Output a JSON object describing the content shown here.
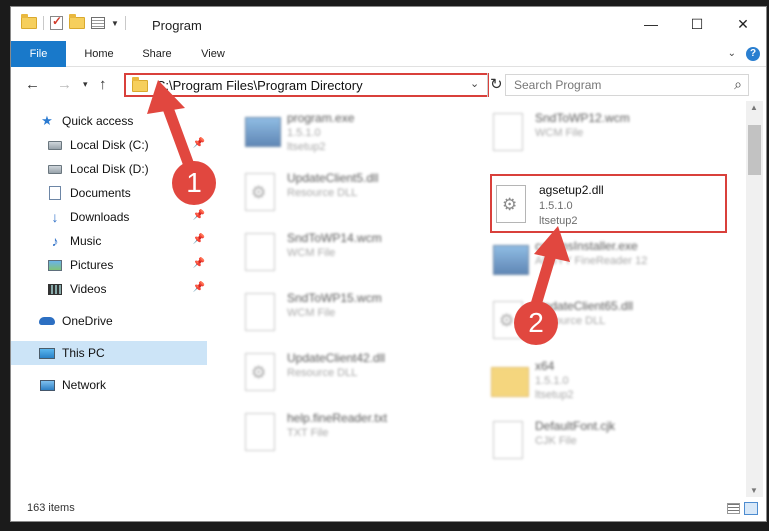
{
  "window": {
    "title": "Program",
    "minimize": "—",
    "maximize": "☐",
    "close": "✕"
  },
  "ribbon": {
    "tabs": [
      "File",
      "Home",
      "Share",
      "View"
    ],
    "expand": "⌄",
    "help": "?"
  },
  "nav": {
    "back": "←",
    "forward": "→",
    "recent": "▾",
    "up": "↑",
    "address": "C:\\Program Files\\Program Directory",
    "address_dropdown": "⌄",
    "refresh": "↻",
    "search_placeholder": "Search Program",
    "search_icon": "⌕"
  },
  "sidebar": {
    "items": [
      {
        "label": "Quick access",
        "icon": "star-icon",
        "pinned": false
      },
      {
        "label": "Local Disk (C:)",
        "icon": "disk-icon",
        "pinned": true
      },
      {
        "label": "Local Disk (D:)",
        "icon": "disk-icon",
        "pinned": false
      },
      {
        "label": "Documents",
        "icon": "documents-icon",
        "pinned": true
      },
      {
        "label": "Downloads",
        "icon": "downloads-icon",
        "pinned": true
      },
      {
        "label": "Music",
        "icon": "music-icon",
        "pinned": true
      },
      {
        "label": "Pictures",
        "icon": "pictures-icon",
        "pinned": true
      },
      {
        "label": "Videos",
        "icon": "videos-icon",
        "pinned": true
      },
      {
        "label": "OneDrive",
        "icon": "onedrive-icon",
        "pinned": false
      },
      {
        "label": "This PC",
        "icon": "this-pc-icon",
        "pinned": false,
        "selected": true
      },
      {
        "label": "Network",
        "icon": "network-icon",
        "pinned": false
      }
    ],
    "pin_glyph": "📌"
  },
  "files": {
    "left": [
      {
        "name": "program.exe",
        "line2": "1.5.1.0",
        "line3": "ltsetup2",
        "type": "exe"
      },
      {
        "name": "UpdateClient5.dll",
        "line2": "Resource DLL",
        "line3": "",
        "type": "dll"
      },
      {
        "name": "SndToWP14.wcm",
        "line2": "WCM File",
        "line3": "",
        "type": "doc"
      },
      {
        "name": "SndToWP15.wcm",
        "line2": "WCM File",
        "line3": "",
        "type": "doc"
      },
      {
        "name": "UpdateClient42.dll",
        "line2": "Resource DLL",
        "line3": "",
        "type": "dll"
      },
      {
        "name": "help.fineReader.txt",
        "line2": "TXT File",
        "line3": "",
        "type": "doc"
      }
    ],
    "right": [
      {
        "name": "SndToWP12.wcm",
        "line2": "WCM File",
        "line3": "",
        "type": "doc"
      },
      {
        "name": "agsetup2.dll",
        "line2": "1.5.1.0",
        "line3": "ltsetup2",
        "type": "dll",
        "highlighted": true
      },
      {
        "name": "commsInstaller.exe",
        "line2": "ABBYY FineReader 12",
        "line3": "",
        "type": "exe"
      },
      {
        "name": "UpdateClient65.dll",
        "line2": "Resource DLL",
        "line3": "",
        "type": "dll"
      },
      {
        "name": "x64",
        "line2": "1.5.1.0",
        "line3": "ltsetup2",
        "type": "folder"
      },
      {
        "name": "DefaultFont.cjk",
        "line2": "CJK File",
        "line3": "",
        "type": "doc"
      }
    ]
  },
  "status": {
    "item_count": "163 items"
  },
  "annotations": {
    "badge1": "1",
    "badge2": "2",
    "color": "#e1473f"
  }
}
